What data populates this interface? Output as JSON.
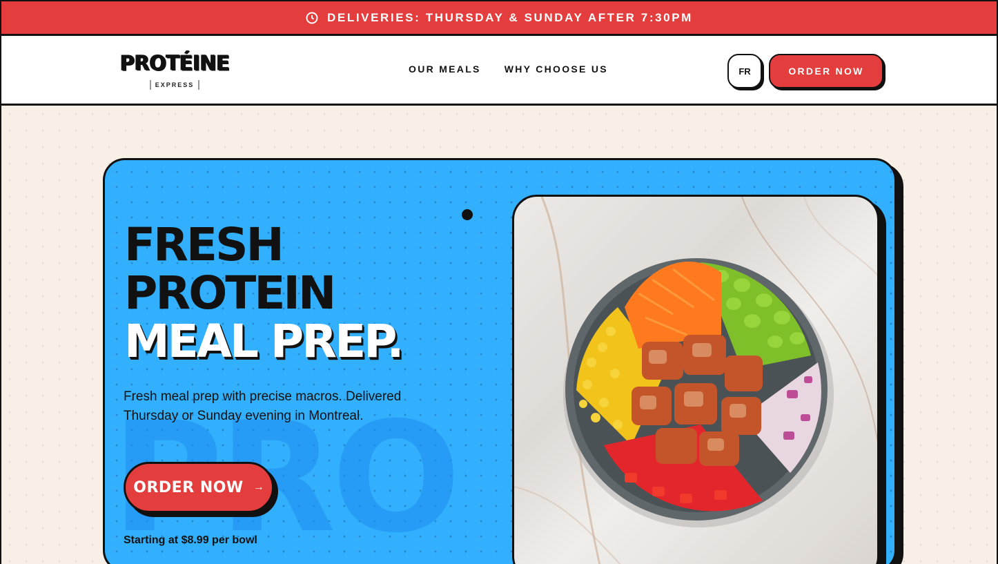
{
  "announcement": {
    "icon": "clock-icon",
    "text": "DELIVERIES: THURSDAY & SUNDAY AFTER 7:30PM"
  },
  "header": {
    "logo": {
      "wordmark": "PROTÉINE",
      "subtitle": "EXPRESS"
    },
    "nav": [
      {
        "label": "OUR MEALS"
      },
      {
        "label": "WHY CHOOSE US"
      }
    ],
    "lang_label": "FR",
    "order_label": "ORDER NOW"
  },
  "hero": {
    "headline_line1": "FRESH",
    "headline_line2": "PROTEIN",
    "headline_line3": "MEAL PREP.",
    "subtext": "Fresh meal prep with precise macros. Delivered Thursday or Sunday evening in Montreal.",
    "cta_label": "ORDER NOW",
    "cta_icon": "arrow-right-icon",
    "price_note": "Starting at $8.99 per bowl",
    "image": "protein-bowl-photo"
  },
  "colors": {
    "announcement_bg": "#e43d3d",
    "hero_bg": "#33b0fd",
    "accent_red": "#e43d3d",
    "ink": "#111111",
    "page_bg": "#f8efe7"
  }
}
